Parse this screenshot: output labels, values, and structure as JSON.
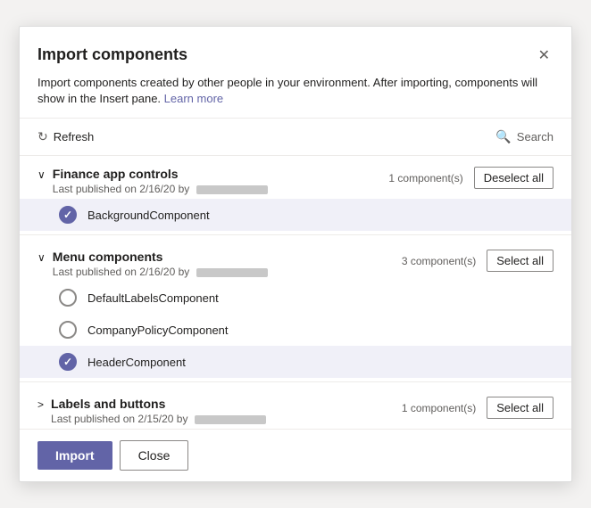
{
  "dialog": {
    "title": "Import components",
    "close_label": "×",
    "description": "Import components created by other people in your environment. After importing, components will show in the Insert pane.",
    "learn_more_label": "Learn more"
  },
  "toolbar": {
    "refresh_label": "Refresh",
    "search_placeholder": "Search"
  },
  "groups": [
    {
      "id": "finance-app-controls",
      "name": "Finance app controls",
      "meta": "Last published on 2/16/20 by",
      "component_count": "1 component(s)",
      "action_label": "Deselect all",
      "action_type": "deselect",
      "expanded": true,
      "components": [
        {
          "id": "bg-component",
          "name": "BackgroundComponent",
          "selected": true
        }
      ]
    },
    {
      "id": "menu-components",
      "name": "Menu components",
      "meta": "Last published on 2/16/20 by",
      "component_count": "3 component(s)",
      "action_label": "Select all",
      "action_type": "select",
      "expanded": true,
      "components": [
        {
          "id": "default-labels",
          "name": "DefaultLabelsComponent",
          "selected": false
        },
        {
          "id": "company-policy",
          "name": "CompanyPolicyComponent",
          "selected": false
        },
        {
          "id": "header-component",
          "name": "HeaderComponent",
          "selected": true
        }
      ]
    },
    {
      "id": "labels-buttons",
      "name": "Labels and buttons",
      "meta": "Last published on 2/15/20 by",
      "component_count": "1 component(s)",
      "action_label": "Select all",
      "action_type": "select",
      "expanded": false,
      "components": []
    }
  ],
  "footer": {
    "import_label": "Import",
    "close_label": "Close"
  },
  "icons": {
    "refresh": "↻",
    "search": "🔍",
    "close": "✕",
    "expand": "∨",
    "collapse": ">"
  }
}
